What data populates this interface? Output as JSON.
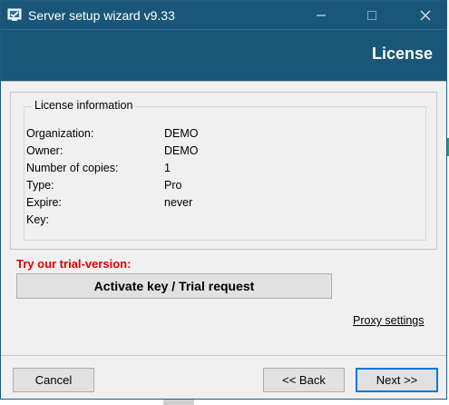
{
  "window": {
    "title": "Server setup wizard v9.33",
    "icon": "app-setup-icon",
    "controls": [
      "minimize-icon",
      "maximize-icon",
      "close-icon"
    ]
  },
  "banner": {
    "title": "License"
  },
  "license": {
    "group_title": "License information",
    "fields": [
      {
        "label": "Organization:",
        "value": "DEMO"
      },
      {
        "label": "Owner:",
        "value": "DEMO"
      },
      {
        "label": "Number of copies:",
        "value": "1"
      },
      {
        "label": "Type:",
        "value": "Pro"
      },
      {
        "label": "Expire:",
        "value": "never"
      },
      {
        "label": "Key:",
        "value": ""
      }
    ]
  },
  "trial": {
    "prompt": "Try our trial-version:",
    "activate_label": "Activate key / Trial request"
  },
  "proxy": {
    "label": "Proxy settings"
  },
  "footer": {
    "cancel_label": "Cancel",
    "back_label": "<< Back",
    "next_label": "Next >>"
  },
  "colors": {
    "titlebar": "#1a5678",
    "trial_prompt": "#e00000",
    "focus_border": "#0078d7"
  }
}
